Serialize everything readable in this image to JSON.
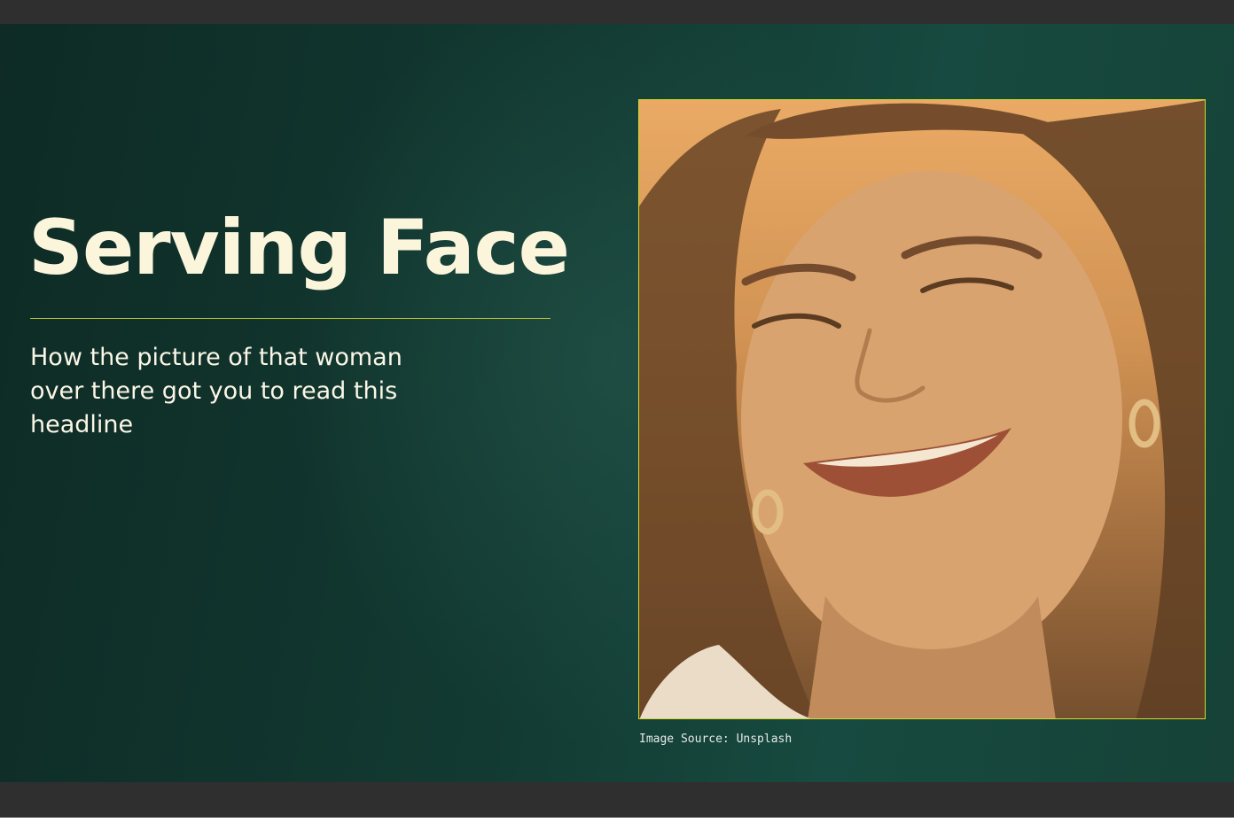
{
  "slide": {
    "title": "Serving Face",
    "subtitle": "How the picture of that woman over there got you to read this headline",
    "image_caption": "Image Source: Unsplash",
    "photo_description_icon": "smiling-woman-photo"
  },
  "colors": {
    "background_dark": "#0e2b25",
    "background_mid": "#174a40",
    "title_text": "#fbf5dc",
    "accent_line": "#b9c43a",
    "photo_border": "#d4d82a",
    "chrome_bar": "#2f2f2f"
  }
}
